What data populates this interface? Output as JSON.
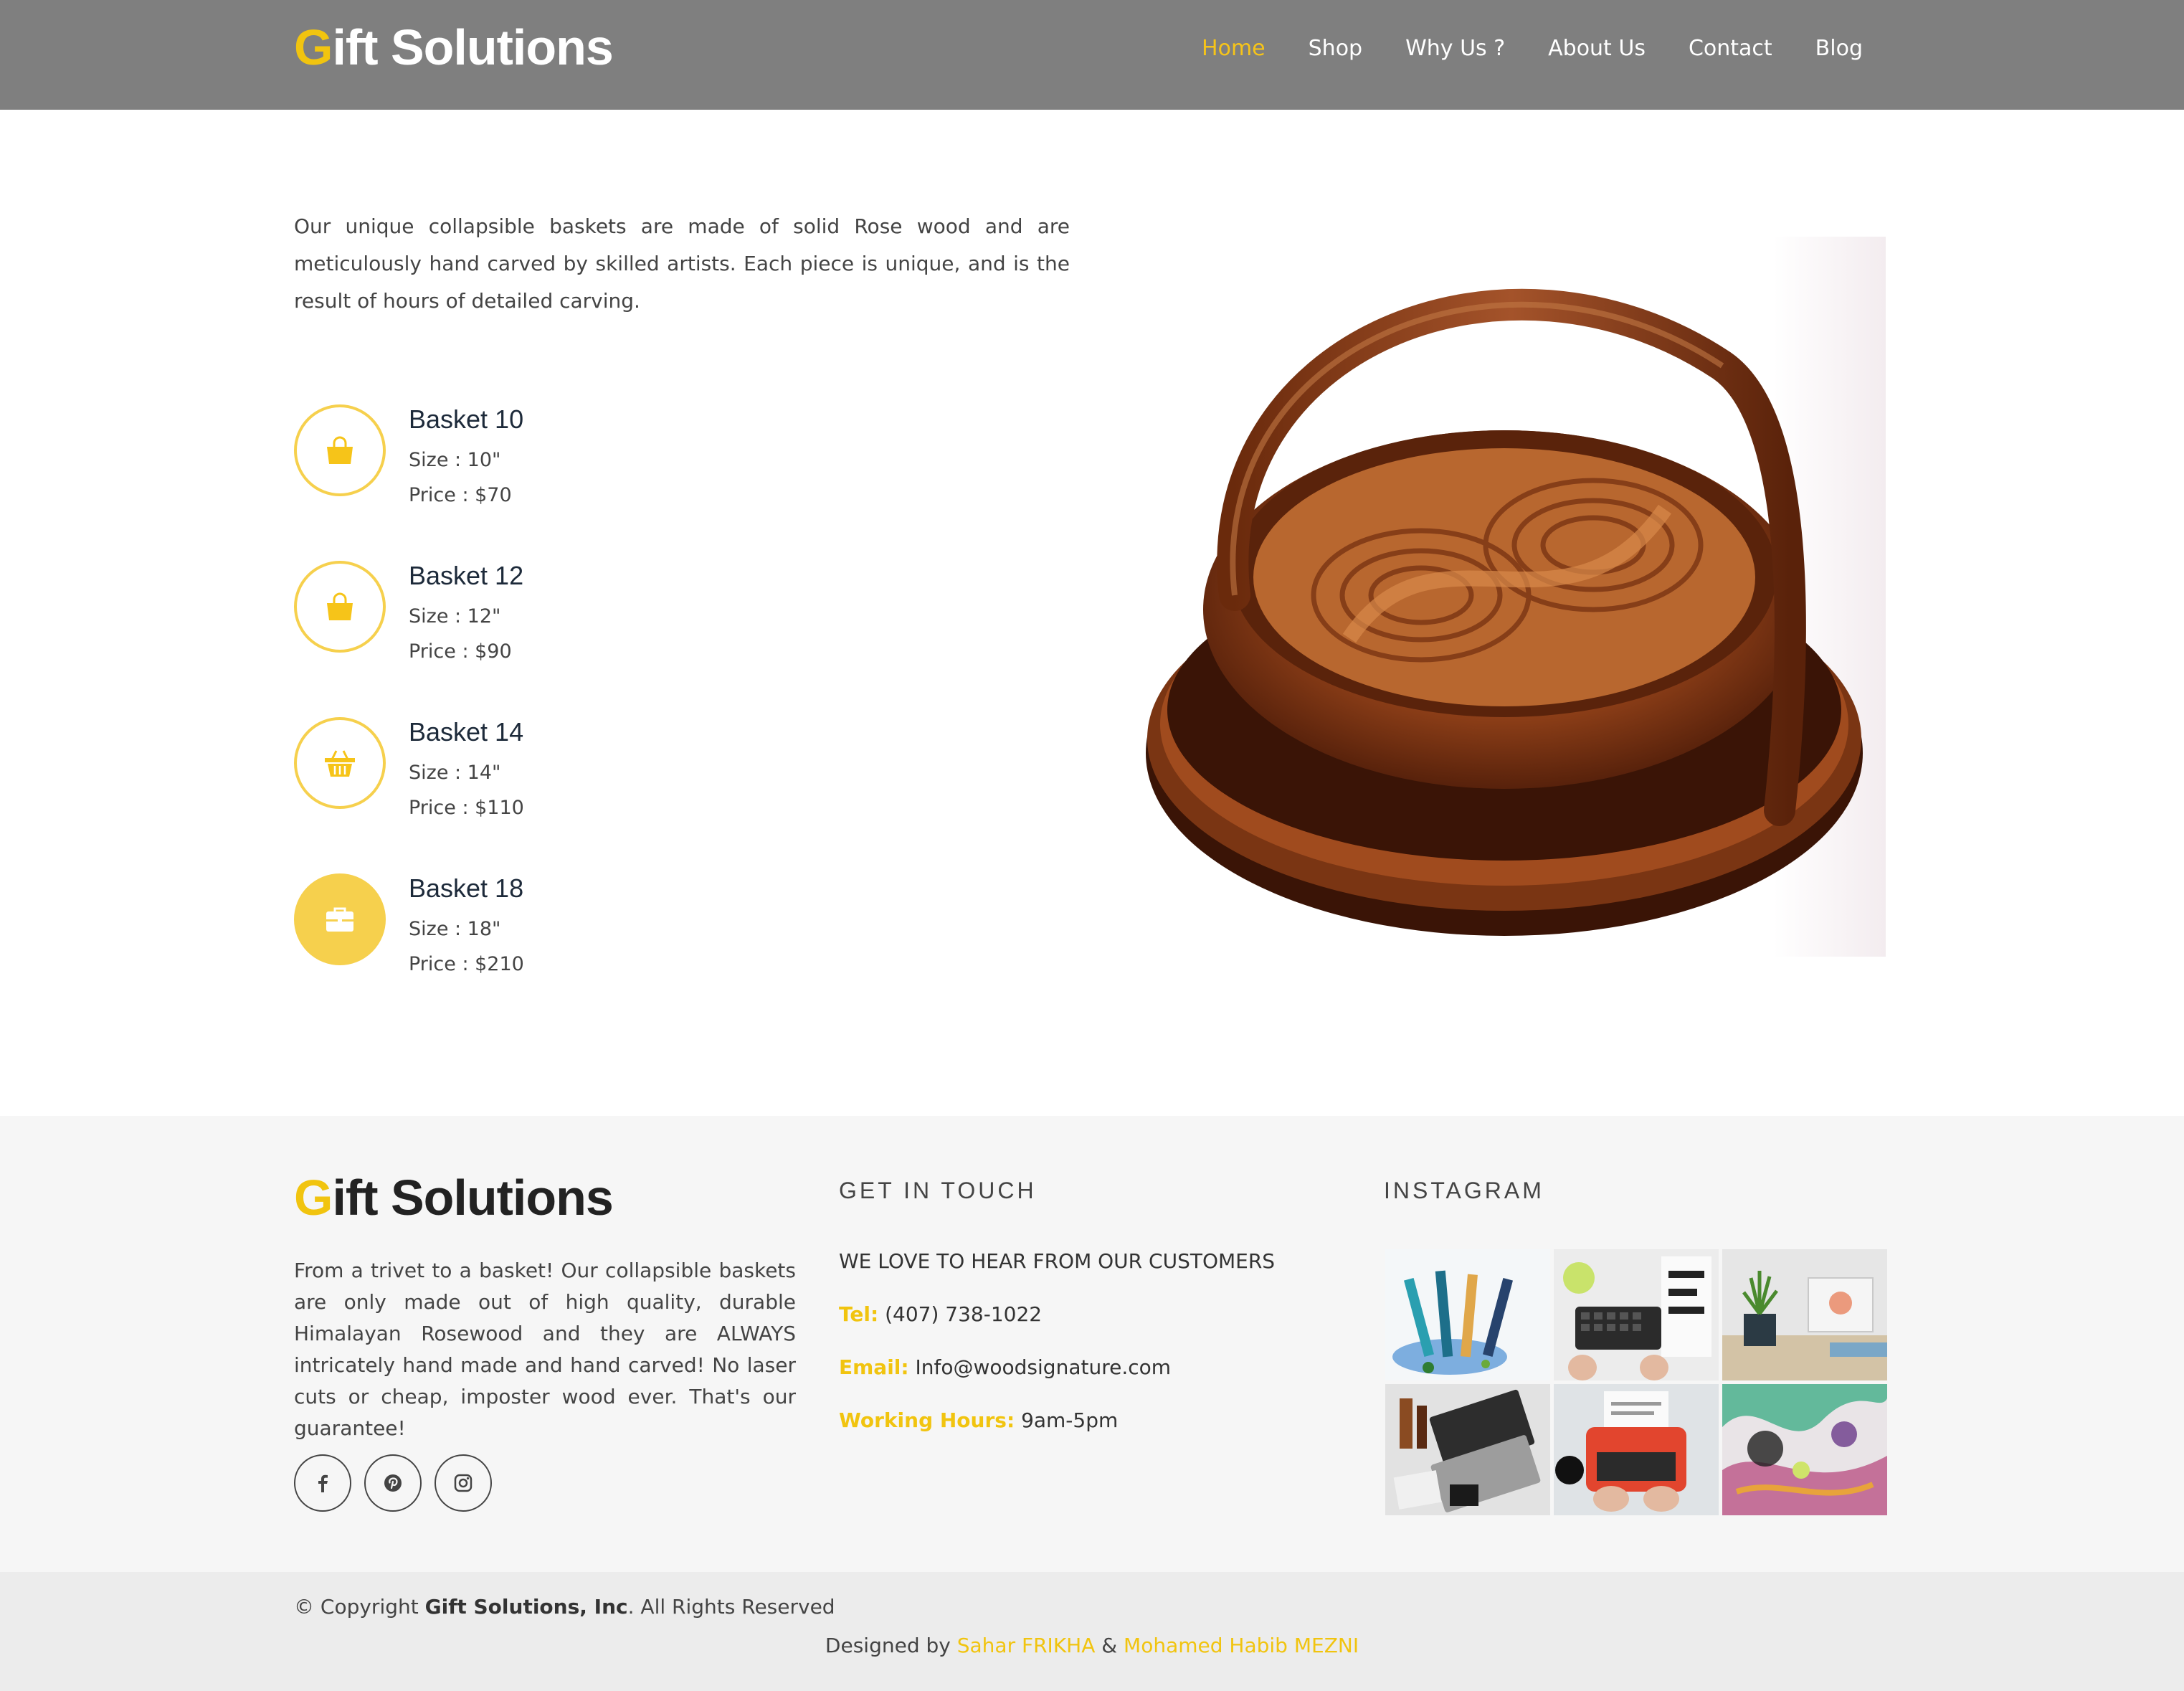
{
  "brand": {
    "logo_first": "G",
    "logo_rest": "ift Solutions"
  },
  "nav": {
    "items": [
      "Home",
      "Shop",
      "Why Us ?",
      "About Us",
      "Contact",
      "Blog"
    ],
    "active": "Home"
  },
  "intro": "Our unique collapsible baskets are made of solid Rose wood and are meticulously hand carved by skilled artists. Each piece is unique, and is the result of hours of detailed carving.",
  "products": [
    {
      "name": "Basket 10",
      "size": "Size : 10\"",
      "price": "Price : $70",
      "icon": "shopping-bag-icon"
    },
    {
      "name": "Basket 12",
      "size": "Size : 12\"",
      "price": "Price : $90",
      "icon": "shopping-bag-icon"
    },
    {
      "name": "Basket 14",
      "size": "Size : 14\"",
      "price": "Price : $110",
      "icon": "shopping-basket-icon"
    },
    {
      "name": "Basket 18",
      "size": "Size : 18\"",
      "price": "Price : $210",
      "icon": "briefcase-icon"
    }
  ],
  "footer": {
    "logo_first": "G",
    "logo_rest": "ift Solutions",
    "about": "From a trivet to a basket! Our collapsible baskets are only made out of high quality, durable Himalayan Rosewood and they are ALWAYS intricately hand made and hand carved! No laser cuts or cheap, imposter wood ever. That's our guarantee!",
    "social": [
      "facebook-icon",
      "pinterest-icon",
      "instagram-icon"
    ],
    "contact": {
      "heading": "GET IN TOUCH",
      "tagline": "WE LOVE TO HEAR FROM OUR CUSTOMERS",
      "tel_label": "Tel:",
      "tel": "(407) 738-1022",
      "email_label": "Email:",
      "email": "Info@woodsignature.com",
      "hours_label": "Working Hours:",
      "hours": "9am-5pm"
    },
    "instagram": {
      "heading": "INSTAGRAM"
    }
  },
  "bottom": {
    "copy_prefix": "© Copyright ",
    "copy_company": "Gift Solutions, Inc",
    "copy_suffix": ". All Rights Reserved",
    "designed_by": "Designed by ",
    "designer_1": "Sahar FRIKHA",
    "and": " & ",
    "designer_2": "Mohamed Habib MEZNI"
  },
  "colors": {
    "accent": "#f1c40f",
    "header_bg": "#7f7f7f",
    "footer_bg": "#f6f6f6",
    "bottom_bg": "#ececec"
  }
}
